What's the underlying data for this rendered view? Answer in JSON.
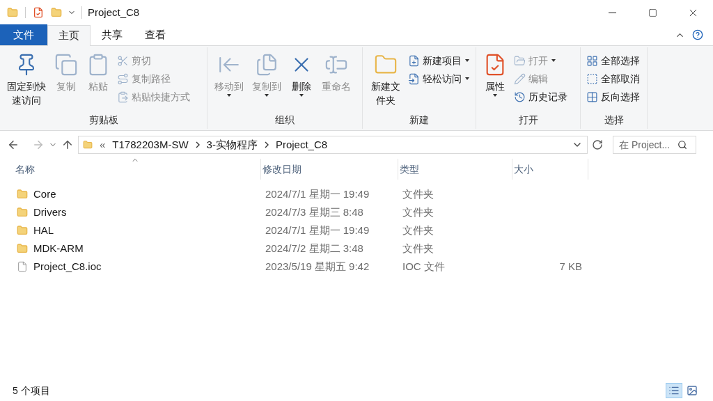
{
  "window": {
    "title": "Project_C8"
  },
  "ribbon_tabs": [
    {
      "label": "文件",
      "kind": "file"
    },
    {
      "label": "主页",
      "kind": "tab",
      "selected": true
    },
    {
      "label": "共享",
      "kind": "tab",
      "selected": false
    },
    {
      "label": "查看",
      "kind": "tab",
      "selected": false
    }
  ],
  "ribbon_groups": [
    {
      "label": "剪贴板",
      "items": [
        {
          "label": "固定到快速访问",
          "kind": "large",
          "disabled": false,
          "dropdown": false
        },
        {
          "label": "复制",
          "kind": "large",
          "disabled": true,
          "dropdown": false
        },
        {
          "label": "粘贴",
          "kind": "large",
          "disabled": true,
          "dropdown": false
        },
        {
          "label": "剪切",
          "kind": "small",
          "disabled": true,
          "dropdown": false
        },
        {
          "label": "复制路径",
          "kind": "small",
          "disabled": true,
          "dropdown": false
        },
        {
          "label": "粘贴快捷方式",
          "kind": "small",
          "disabled": true,
          "dropdown": false
        }
      ]
    },
    {
      "label": "组织",
      "items": [
        {
          "label": "移动到",
          "kind": "large",
          "disabled": true,
          "dropdown": true
        },
        {
          "label": "复制到",
          "kind": "large",
          "disabled": true,
          "dropdown": true
        },
        {
          "label": "删除",
          "kind": "large",
          "disabled": false,
          "dropdown": true
        },
        {
          "label": "重命名",
          "kind": "large",
          "disabled": true,
          "dropdown": false
        }
      ]
    },
    {
      "label": "新建",
      "items": [
        {
          "label": "新建文件夹",
          "kind": "large",
          "disabled": false,
          "dropdown": false
        },
        {
          "label": "新建项目",
          "kind": "small",
          "disabled": false,
          "dropdown": true
        },
        {
          "label": "轻松访问",
          "kind": "small",
          "disabled": false,
          "dropdown": true
        }
      ]
    },
    {
      "label": "打开",
      "items": [
        {
          "label": "属性",
          "kind": "large",
          "disabled": false,
          "dropdown": true
        },
        {
          "label": "打开",
          "kind": "small",
          "disabled": true,
          "dropdown": true
        },
        {
          "label": "编辑",
          "kind": "small",
          "disabled": true,
          "dropdown": false
        },
        {
          "label": "历史记录",
          "kind": "small",
          "disabled": false,
          "dropdown": false
        }
      ]
    },
    {
      "label": "选择",
      "items": [
        {
          "label": "全部选择",
          "kind": "small",
          "disabled": false,
          "dropdown": false
        },
        {
          "label": "全部取消",
          "kind": "small",
          "disabled": false,
          "dropdown": false
        },
        {
          "label": "反向选择",
          "kind": "small",
          "disabled": false,
          "dropdown": false
        }
      ]
    }
  ],
  "address_bar": {
    "overflow": "«",
    "crumbs": [
      "T1782203M-SW",
      "3-实物程序",
      "Project_C8"
    ]
  },
  "search": {
    "placeholder": "在 Project..."
  },
  "table": {
    "columns": [
      "名称",
      "修改日期",
      "类型",
      "大小"
    ],
    "rows": [
      {
        "kind": "folder",
        "name": "Core",
        "date": "2024/7/1 星期一 19:49",
        "type": "文件夹"
      },
      {
        "kind": "folder",
        "name": "Drivers",
        "date": "2024/7/3 星期三 8:48",
        "type": "文件夹"
      },
      {
        "kind": "folder",
        "name": "HAL",
        "date": "2024/7/1 星期一 19:49",
        "type": "文件夹"
      },
      {
        "kind": "folder",
        "name": "MDK-ARM",
        "date": "2024/7/2 星期二 3:48",
        "type": "文件夹"
      },
      {
        "kind": "file",
        "name": "Project_C8.ioc",
        "date": "2023/5/19 星期五 9:42",
        "type": "IOC 文件",
        "size": "7 KB"
      }
    ]
  },
  "status_bar": {
    "count": "5 个项目",
    "views": [
      {
        "kind": "details",
        "selected": true
      },
      {
        "kind": "large_icons",
        "selected": false
      }
    ]
  }
}
